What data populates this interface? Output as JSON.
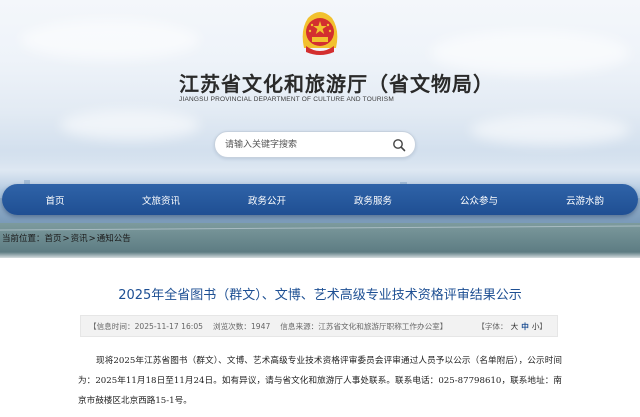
{
  "header": {
    "title": "江苏省文化和旅游厅（省文物局）",
    "subtitle": "JIANGSU PROVINCIAL DEPARTMENT OF CULTURE AND TOURISM",
    "emblem_icon": "national-emblem-icon"
  },
  "search": {
    "placeholder": "请输入关键字搜索",
    "icon": "search-icon"
  },
  "nav": {
    "items": [
      {
        "label": "首页"
      },
      {
        "label": "文旅资讯"
      },
      {
        "label": "政务公开"
      },
      {
        "label": "政务服务"
      },
      {
        "label": "公众参与"
      },
      {
        "label": "云游水韵"
      }
    ]
  },
  "breadcrumb": {
    "prefix": "当前位置：",
    "items": [
      "首页",
      "资讯",
      "通知公告"
    ],
    "separator": ">"
  },
  "article": {
    "title": "2025年全省图书（群文）、文博、艺术高级专业技术资格评审结果公示",
    "meta": {
      "time_label": "【信息时间：",
      "time_value": "2025-11-17 16:05",
      "views_label": "浏览次数：",
      "views_value": "1947",
      "source_label": "信息来源：",
      "source_value": "江苏省文化和旅游厅职称工作办公室】",
      "font_label": "【字体：",
      "font_large": "大",
      "font_medium": "中",
      "font_small": "小",
      "font_end": "】"
    },
    "body": "现将2025年江苏省图书（群文）、文博、艺术高级专业技术资格评审委员会评审通过人员予以公示（名单附后），公示时间为：2025年11月18日至11月24日。如有异议，请与省文化和旅游厅人事处联系。联系电话：025-87798610，联系地址：南京市鼓楼区北京西路15-1号。"
  },
  "colors": {
    "nav_bg": "#1f4f93",
    "title_blue": "#1d4f93",
    "emblem_red": "#d32f2f",
    "emblem_gold": "#f2c12e"
  }
}
